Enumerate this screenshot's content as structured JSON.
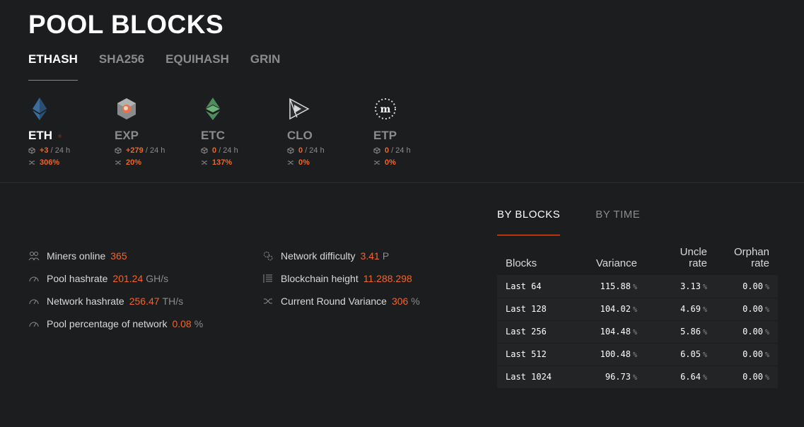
{
  "page": {
    "title": "POOL BLOCKS"
  },
  "algo_tabs": [
    {
      "label": "ETHASH",
      "active": true
    },
    {
      "label": "SHA256",
      "active": false
    },
    {
      "label": "EQUIHASH",
      "active": false
    },
    {
      "label": "GRIN",
      "active": false
    }
  ],
  "coins": [
    {
      "name": "ETH",
      "blocks": "+3",
      "period": "/ 24 h",
      "variance": "306%",
      "active": true,
      "icon": "ethereum-icon"
    },
    {
      "name": "EXP",
      "blocks": "+279",
      "period": "/ 24 h",
      "variance": "20%",
      "active": false,
      "icon": "expanse-icon"
    },
    {
      "name": "ETC",
      "blocks": "0",
      "period": "/ 24 h",
      "variance": "137%",
      "active": false,
      "icon": "ethereum-classic-icon"
    },
    {
      "name": "CLO",
      "blocks": "0",
      "period": "/ 24 h",
      "variance": "0%",
      "active": false,
      "icon": "callisto-icon"
    },
    {
      "name": "ETP",
      "blocks": "0",
      "period": "/ 24 h",
      "variance": "0%",
      "active": false,
      "icon": "metaverse-icon"
    }
  ],
  "stats_left": [
    {
      "label": "Miners online",
      "value": "365",
      "unit": "",
      "icon": "miners-icon"
    },
    {
      "label": "Pool hashrate",
      "value": "201.24",
      "unit": "GH/s",
      "icon": "gauge-icon"
    },
    {
      "label": "Network hashrate",
      "value": "256.47",
      "unit": "TH/s",
      "icon": "gauge-icon"
    },
    {
      "label": "Pool percentage of network",
      "value": "0.08",
      "unit": "%",
      "icon": "gauge-icon"
    }
  ],
  "stats_right": [
    {
      "label": "Network difficulty",
      "value": "3.41",
      "unit": "P",
      "icon": "gears-icon"
    },
    {
      "label": "Blockchain height",
      "value": "11.288.298",
      "unit": "",
      "icon": "list-icon"
    },
    {
      "label": "Current Round Variance",
      "value": "306",
      "unit": "%",
      "icon": "shuffle-icon"
    }
  ],
  "variance_tabs": [
    {
      "label": "BY BLOCKS",
      "active": true
    },
    {
      "label": "BY TIME",
      "active": false
    }
  ],
  "variance_table": {
    "headers": [
      "Blocks",
      "Variance",
      "Uncle rate",
      "Orphan rate"
    ],
    "rows": [
      [
        "Last 64",
        "115.88",
        "3.13",
        "0.00"
      ],
      [
        "Last 128",
        "104.02",
        "4.69",
        "0.00"
      ],
      [
        "Last 256",
        "104.48",
        "5.86",
        "0.00"
      ],
      [
        "Last 512",
        "100.48",
        "6.05",
        "0.00"
      ],
      [
        "Last 1024",
        "96.73",
        "6.64",
        "0.00"
      ]
    ],
    "pct": "%"
  },
  "colors": {
    "accent": "#f26522",
    "background": "#1c1d1f"
  }
}
